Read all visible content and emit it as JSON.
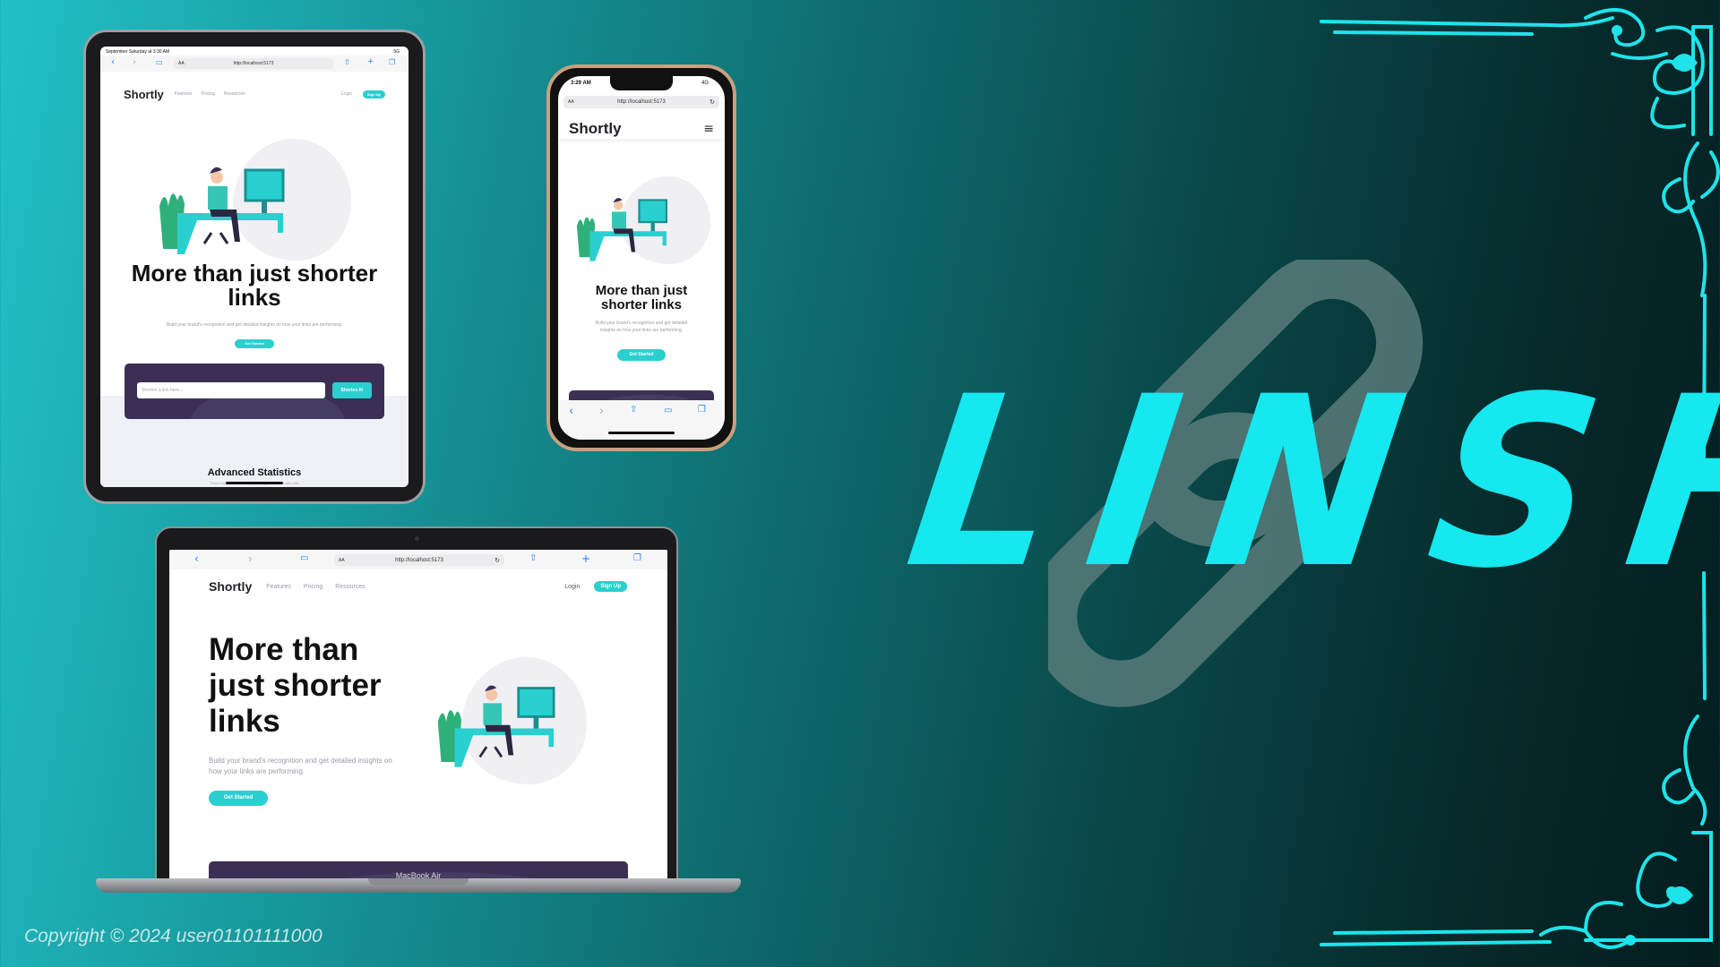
{
  "branding": {
    "title": "LINSH",
    "copyright": "Copyright © 2024 user01101111000",
    "accent_color": "#15e8ef",
    "link_icon": "chain-link-icon",
    "corner_ornament": "filigree-ornament"
  },
  "site": {
    "logo": "Shortly",
    "nav": [
      "Features",
      "Pricing",
      "Resources"
    ],
    "login": "Login",
    "signup": "Sign Up",
    "headline_wide": [
      "More than",
      "just shorter",
      "links"
    ],
    "headline_tablet": [
      "More than just shorter",
      "links"
    ],
    "headline_phone": [
      "More than just",
      "shorter links"
    ],
    "description": "Build your brand's recognition and get detailed insights on how your links are performing.",
    "description_wide": [
      "Build your brand's recognition and get detailed insights on",
      "how your links are performing."
    ],
    "description_phone": [
      "Build your brand's recognition and get detailed",
      "insights on how your links are performing."
    ],
    "cta": "Get Started",
    "shorten_placeholder": "Shorten a link here...",
    "shorten_button": "Shorten It!",
    "stats_heading": "Advanced Statistics",
    "stats_sub": "Track how your links are performing across the web with"
  },
  "browser": {
    "url": "http://localhost:5173",
    "text_size": "AA"
  },
  "tablet": {
    "status_time": "September Saturday at 3:30 AM",
    "status_right": "5G"
  },
  "phone": {
    "status_time": "3:29 AM",
    "status_right": "4G"
  },
  "laptop": {
    "model": "MacBook Air"
  },
  "colors": {
    "brand_cyan": "#2acfcf",
    "dark_violet": "#3b3054",
    "background_dark": "#062a2b"
  }
}
